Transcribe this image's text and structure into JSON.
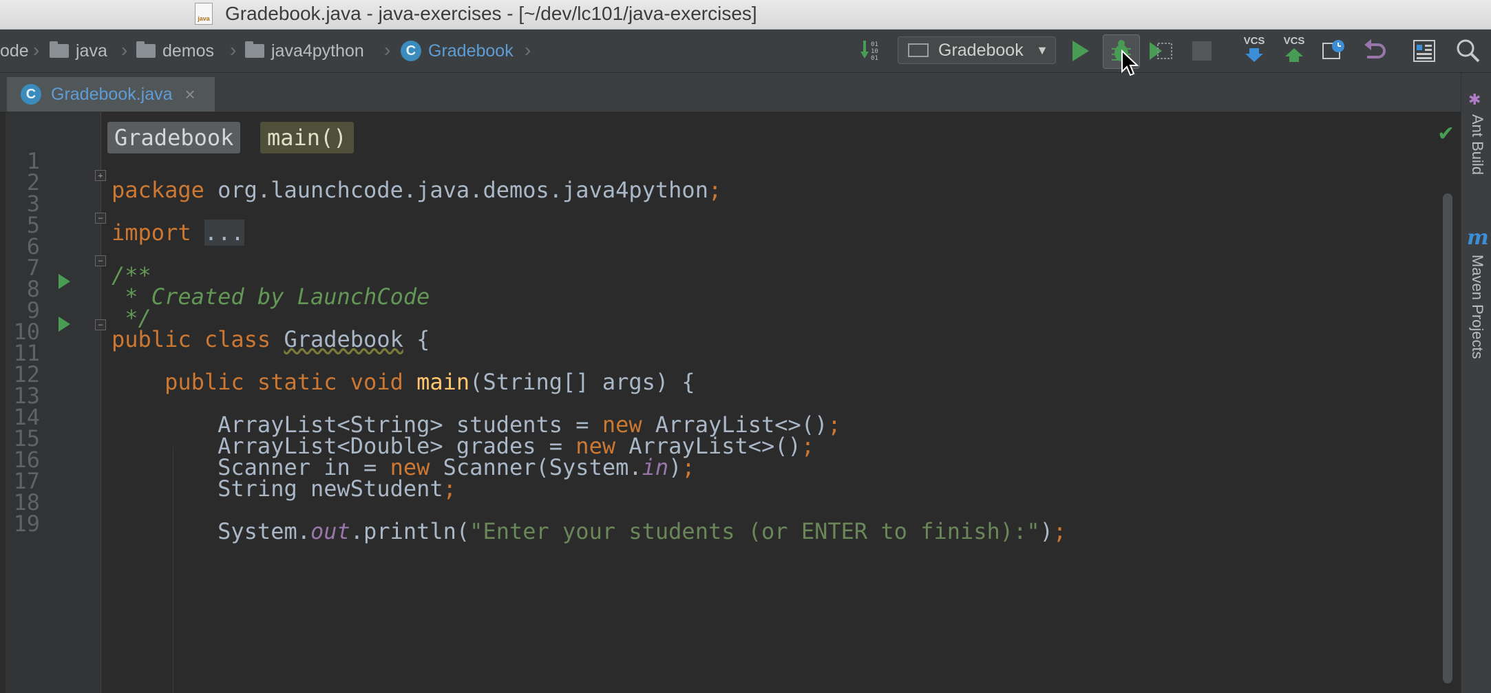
{
  "window": {
    "title": "Gradebook.java - java-exercises - [~/dev/lc101/java-exercises]",
    "file_icon_text": "java"
  },
  "navbar": {
    "breadcrumbs": [
      "ode",
      "java",
      "demos",
      "java4python",
      "Gradebook"
    ],
    "run_config": "Gradebook",
    "vcs_update_label": "VCS",
    "vcs_commit_label": "VCS"
  },
  "tabs": [
    {
      "label": "Gradebook.java",
      "active": true
    }
  ],
  "editor": {
    "breadcrumbs": [
      "Gradebook",
      "main()"
    ],
    "lines": [
      {
        "n": "1",
        "code": "package org.launchcode.java.demos.java4python;"
      },
      {
        "n": "2",
        "code": ""
      },
      {
        "n": "3",
        "code": "import ..."
      },
      {
        "n": "5",
        "code": ""
      },
      {
        "n": "6",
        "code": "/**"
      },
      {
        "n": "7",
        "code": " * Created by LaunchCode"
      },
      {
        "n": "8",
        "code": " */"
      },
      {
        "n": "9",
        "code": "public class Gradebook {"
      },
      {
        "n": "10",
        "code": ""
      },
      {
        "n": "11",
        "code": "    public static void main(String[] args) {"
      },
      {
        "n": "12",
        "code": ""
      },
      {
        "n": "13",
        "code": "        ArrayList<String> students = new ArrayList<>();"
      },
      {
        "n": "14",
        "code": "        ArrayList<Double> grades = new ArrayList<>();"
      },
      {
        "n": "15",
        "code": "        Scanner in = new Scanner(System.in);"
      },
      {
        "n": "16",
        "code": "        String newStudent;"
      },
      {
        "n": "17",
        "code": ""
      },
      {
        "n": "18",
        "code": "        System.out.println(\"Enter your students (or ENTER to finish):\");"
      },
      {
        "n": "19",
        "code": ""
      }
    ]
  },
  "tool_windows": {
    "right": [
      "Ant Build",
      "Maven Projects"
    ]
  },
  "colors": {
    "keyword": "#cc7832",
    "method": "#ffc66d",
    "string": "#6a8759",
    "comment": "#629755",
    "static_field": "#9876aa",
    "plain": "#a9b7c6",
    "run_green": "#499c54"
  }
}
